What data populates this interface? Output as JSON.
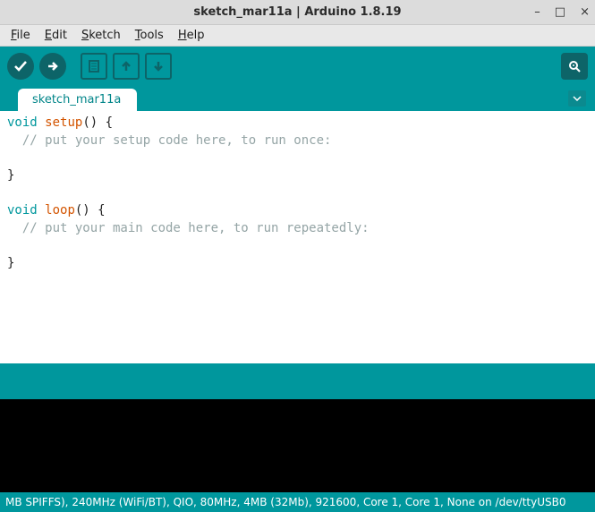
{
  "window": {
    "title": "sketch_mar11a | Arduino 1.8.19"
  },
  "menu": {
    "file": "File",
    "edit": "Edit",
    "sketch": "Sketch",
    "tools": "Tools",
    "help": "Help"
  },
  "tabs": {
    "active": "sketch_mar11a"
  },
  "code": {
    "l1a": "void",
    "l1b": " ",
    "l1c": "setup",
    "l1d": "() {",
    "l2": "  // put your setup code here, to run once:",
    "l3": "",
    "l4": "}",
    "l5": "",
    "l6a": "void",
    "l6b": " ",
    "l6c": "loop",
    "l6d": "() {",
    "l7": "  // put your main code here, to run repeatedly:",
    "l8": "",
    "l9": "}"
  },
  "status": {
    "text": "MB SPIFFS), 240MHz (WiFi/BT), QIO, 80MHz, 4MB (32Mb), 921600, Core 1, Core 1, None on /dev/ttyUSB0"
  }
}
